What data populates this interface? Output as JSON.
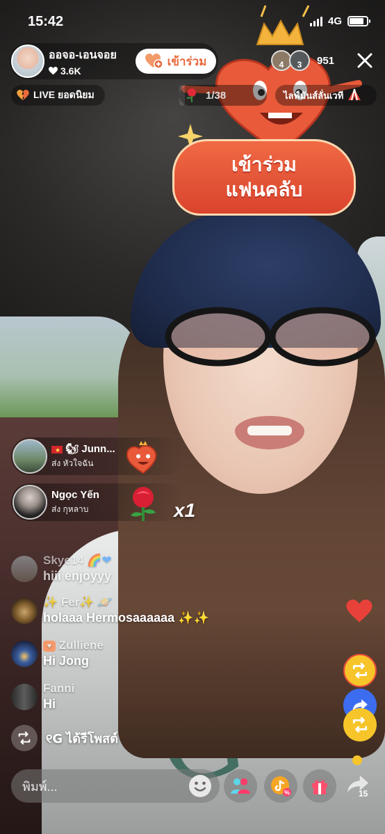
{
  "status_bar": {
    "time": "15:42",
    "network": "4G",
    "battery_level": 0.85
  },
  "host": {
    "name": "ออจอ-เอนจอย",
    "likes": "3.6K",
    "join_button": "เข้าร่วม"
  },
  "viewers": {
    "top_ranks": [
      "4",
      "3"
    ],
    "count": "951"
  },
  "badges": {
    "live": "LIVE ยอดนิยม",
    "gift_goal": "1/38",
    "gift_goal_progress": 0.026,
    "fun_badge": "ไลฟ์มันส์ลั่นเวที"
  },
  "fan_club_promo": {
    "line1": "เข้าร่วม",
    "line2": "แฟนคลับ"
  },
  "gifts": [
    {
      "name": "Junn...",
      "action": "ส่ง หัวใจฉัน",
      "gift_icon": "heart-mascot-icon"
    },
    {
      "name": "Ngọc Yến",
      "action": "ส่ง กุหลาบ",
      "gift_icon": "rose-icon",
      "multiplier": "x1"
    }
  ],
  "comments": [
    {
      "name": "Skye14",
      "message": "hiii enjoyyy"
    },
    {
      "name": "✨ Fer✨",
      "message": "holaaa Hermosaaaaaa ✨✨"
    },
    {
      "name": "Zulliene",
      "message": "Hi Jong"
    },
    {
      "name": "Fanni",
      "message": "Hi"
    }
  ],
  "repost": {
    "text": "ได้รีโพสต์"
  },
  "bottom_bar": {
    "placeholder": "พิมพ์...",
    "share_count": "15"
  },
  "colors": {
    "accent": "#e86a3c",
    "repost_yellow": "#f7c529",
    "share_blue": "#3c6df0",
    "heart_red": "#e8413a"
  }
}
